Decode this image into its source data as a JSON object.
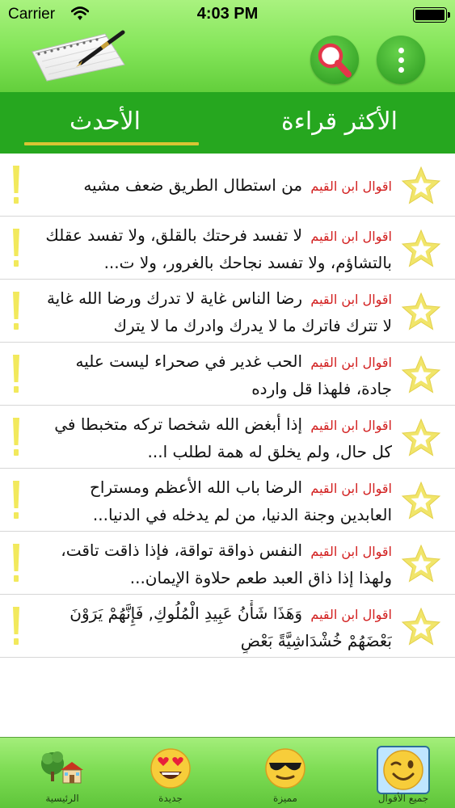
{
  "status": {
    "carrier": "Carrier",
    "time": "4:03 PM"
  },
  "tabs": {
    "most_read": "الأكثر قراءة",
    "latest": "الأحدث"
  },
  "list": {
    "tag": "اقوال ابن القيم",
    "items": [
      {
        "text": "من استطال الطريق ضعف مشيه"
      },
      {
        "text": "لا تفسد فرحتك بالقلق، ولا تفسد عقلك بالتشاؤم، ولا تفسد نجاحك بالغرور، ولا ت..."
      },
      {
        "text": "رضا الناس غاية لا تدرك ورضا الله غاية لا تترك فاترك ما لا يدرك وادرك ما لا يترك"
      },
      {
        "text": "الحب غدير في صحراء ليست عليه جادة، فلهذا قل وارده"
      },
      {
        "text": "إذا أبغض الله شخصا تركه متخبطا في كل حال، ولم يخلق له همة لطلب ا..."
      },
      {
        "text": "الرضا باب الله الأعظم ومستراح العابدين وجنة الدنيا، من لم يدخله في الدنيا..."
      },
      {
        "text": "النفس ذواقة تواقة، فإذا ذاقت تاقت، ولهذا إذا ذاق العبد طعم حلاوة الإيمان..."
      },
      {
        "text": "وَهَذَا شَأْنُ عَبِيدِ الْمُلُوكِ, فَإِنَّهُمْ يَرَوْنَ بَعْضَهُمْ خُشْدَاشِيَّةً بَعْضٍ"
      }
    ]
  },
  "bottom_tabs": [
    {
      "label": "جميع الأقوال",
      "icon": "wink-emoji-icon"
    },
    {
      "label": "مميزة",
      "icon": "sunglasses-emoji-icon"
    },
    {
      "label": "جديدة",
      "icon": "heart-eyes-emoji-icon"
    },
    {
      "label": "الرئيسية",
      "icon": "home-tree-icon"
    }
  ],
  "colors": {
    "header_green": "#86e65b",
    "tab_green": "#26a71f",
    "underline_gold": "#d9c433",
    "tag_red": "#d21e1e",
    "star_yellow": "#f1e56a"
  }
}
